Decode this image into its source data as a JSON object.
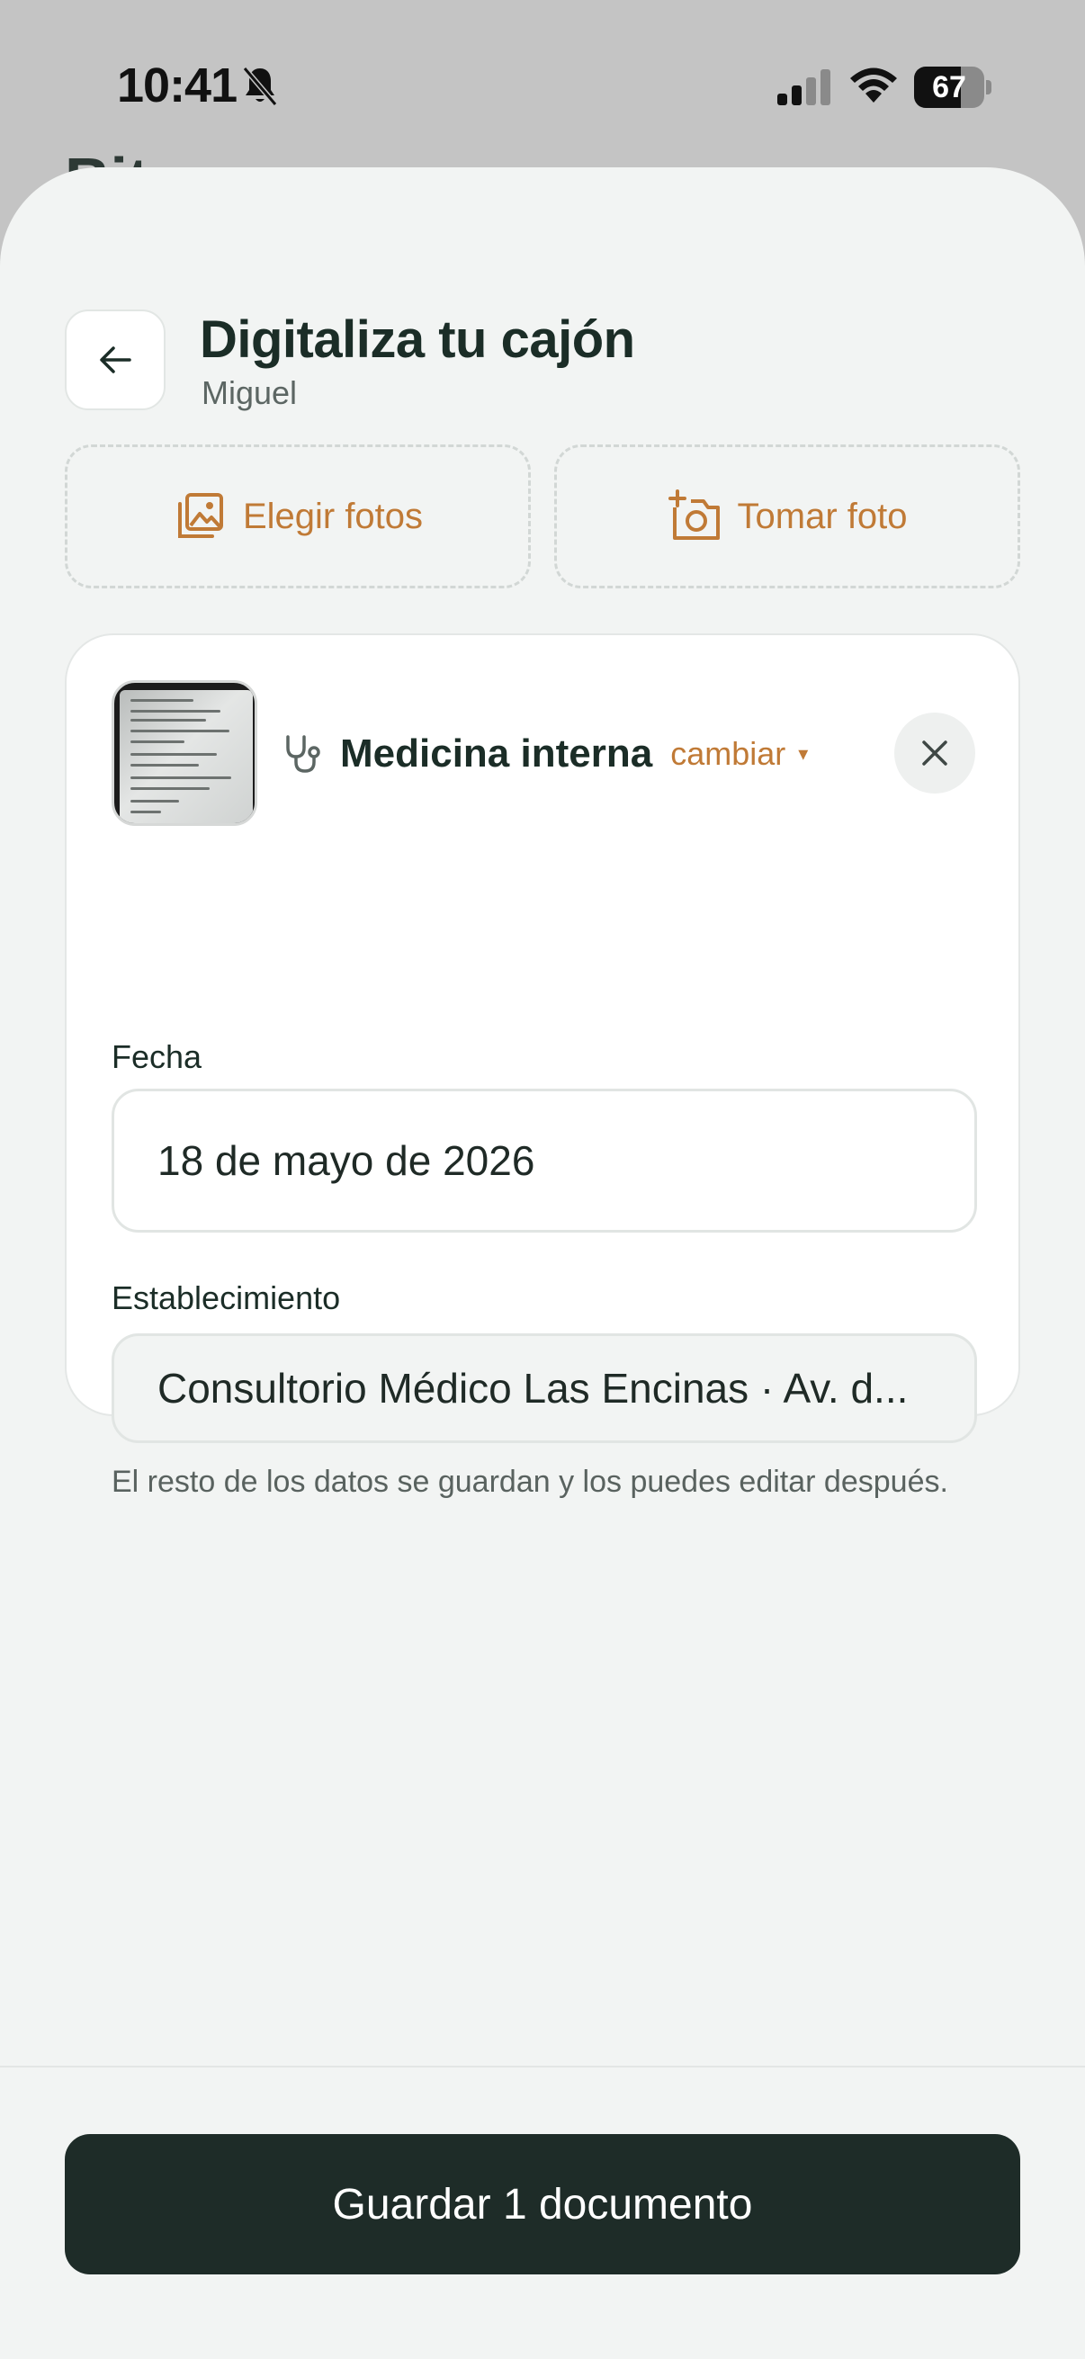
{
  "status_bar": {
    "time": "10:41",
    "battery_text": "67",
    "battery_level": 0.67,
    "icons": [
      "bell-off-icon",
      "signal-icon",
      "wifi-icon",
      "battery-icon"
    ]
  },
  "background": {
    "title_fragment": "Bit"
  },
  "header": {
    "title": "Digitaliza tu cajón",
    "subtitle": "Miguel",
    "back_icon": "arrow-left-icon"
  },
  "photo_actions": {
    "choose_label": "Elegir fotos",
    "choose_icon": "gallery-icon",
    "take_label": "Tomar foto",
    "take_icon": "camera-plus-icon"
  },
  "document": {
    "specialty_icon": "stethoscope-icon",
    "specialty": "Medicina interna",
    "change_label": "cambiar",
    "caret": "▾",
    "date_label": "Fecha",
    "date_value": "18 de mayo de 2026",
    "place_label": "Establecimiento",
    "place_value": "Consultorio Médico Las Encinas · Av. d...",
    "help_text": "El resto de los datos se guardan y los puedes editar después."
  },
  "footer": {
    "save_label": "Guardar 1 documento"
  },
  "colors": {
    "accent": "#c07a36",
    "primary_dark": "#1e2c28",
    "sheet_bg": "#f2f4f3"
  }
}
